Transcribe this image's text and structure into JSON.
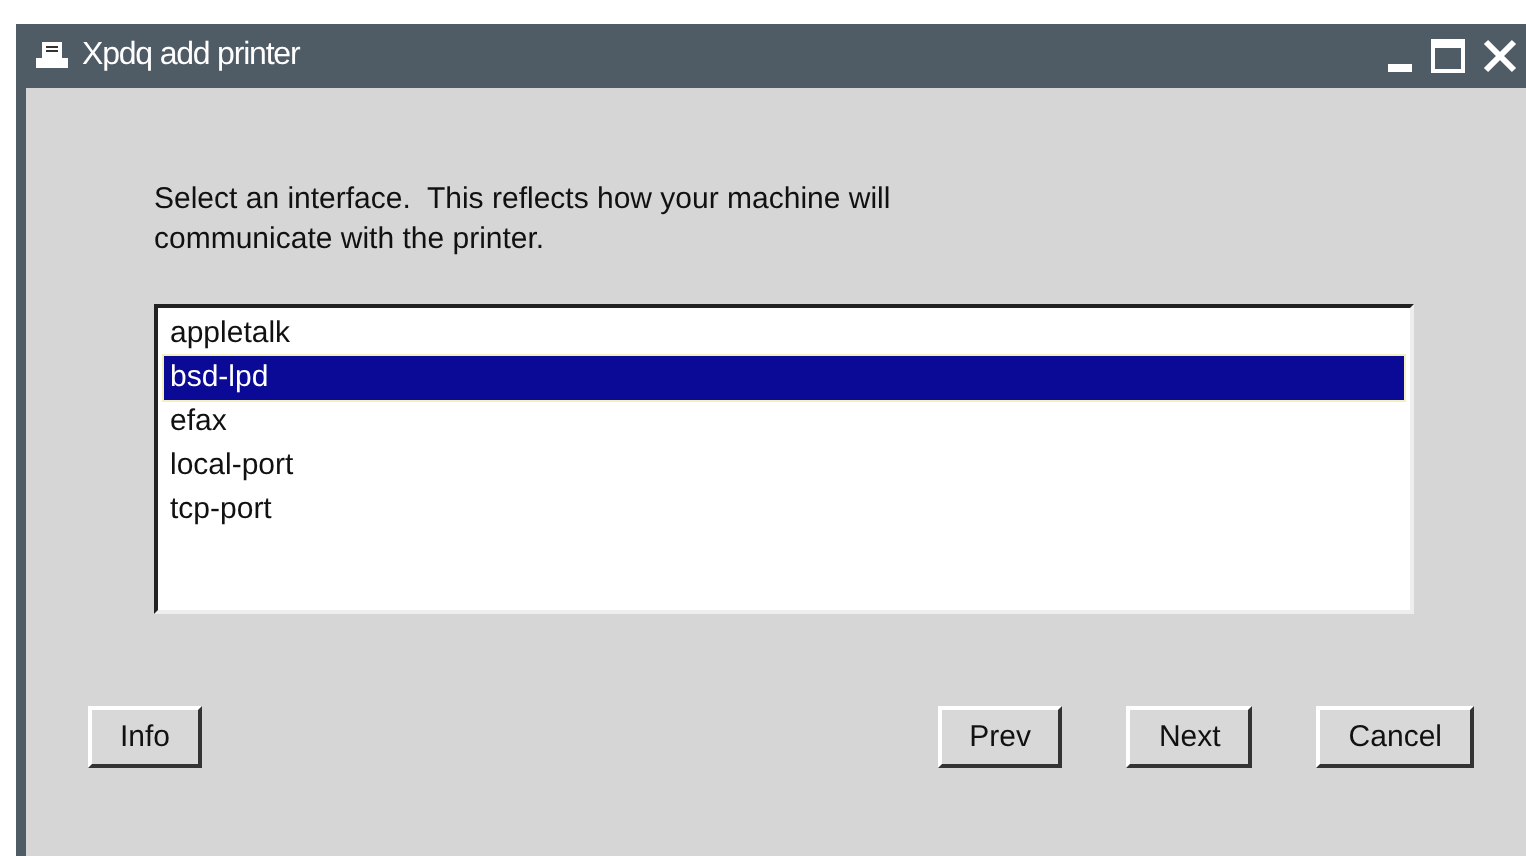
{
  "window": {
    "title": "Xpdq add printer"
  },
  "prompt": "Select an interface.  This reflects how your machine will communicate with the printer.",
  "interfaces": [
    {
      "label": "appletalk",
      "selected": false
    },
    {
      "label": "bsd-lpd",
      "selected": true
    },
    {
      "label": "efax",
      "selected": false
    },
    {
      "label": "local-port",
      "selected": false
    },
    {
      "label": "tcp-port",
      "selected": false
    }
  ],
  "buttons": [
    {
      "label": "Info",
      "kind": "left"
    },
    {
      "label": "Prev",
      "kind": "right"
    },
    {
      "label": "Next",
      "kind": "right"
    },
    {
      "label": "Cancel",
      "kind": "right"
    }
  ]
}
